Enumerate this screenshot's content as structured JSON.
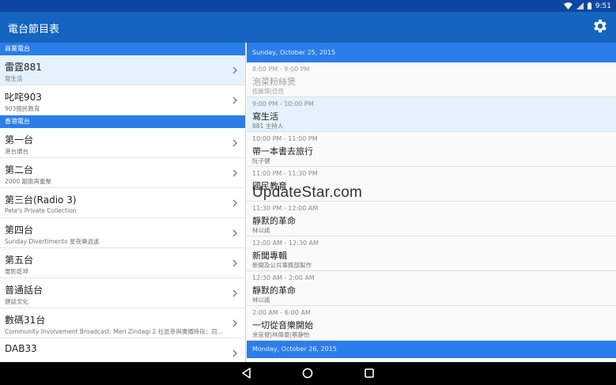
{
  "status": {
    "time": "9:51"
  },
  "app": {
    "title": "電台節目表"
  },
  "sections": [
    {
      "label": "商業電台",
      "stations": [
        {
          "name": "雷霆881",
          "sub": "寫生活",
          "selected": true
        },
        {
          "name": "叱咤903",
          "sub": "903國民教育",
          "selected": false
        }
      ]
    },
    {
      "label": "香港電台",
      "stations": [
        {
          "name": "第一台",
          "sub": "港台讀台",
          "selected": false
        },
        {
          "name": "第二台",
          "sub": "2000 靚歌再重聚",
          "selected": false
        },
        {
          "name": "第三台(Radio 3)",
          "sub": "Pete's Private Collection",
          "selected": false
        },
        {
          "name": "第四台",
          "sub": "Sunday Divertimento 星夜樂逍遙",
          "selected": false
        },
        {
          "name": "第五台",
          "sub": "電影乾坤",
          "selected": false
        },
        {
          "name": "普通話台",
          "sub": "健談文化",
          "selected": false
        },
        {
          "name": "數碼31台",
          "sub": "Community Involvement Broadcast: Meri Zindagi 2 社區參與廣播時段：同...",
          "selected": false
        },
        {
          "name": "DAB33",
          "sub": "",
          "selected": false
        }
      ]
    }
  ],
  "schedule": {
    "date1": "Sunday, October 25, 2015",
    "programs": [
      {
        "time": "8:00 PM - 9:00 PM",
        "title": "泡菜粉絲煲",
        "host": "伍飯琪|伍恆",
        "state": "past"
      },
      {
        "time": "9:00 PM - 10:00 PM",
        "title": "寫生活",
        "host": "881 主持人",
        "state": "current"
      },
      {
        "time": "10:00 PM - 11:00 PM",
        "title": "帶一本書去旅行",
        "host": "阮子健",
        "state": "future"
      },
      {
        "time": "11:00 PM - 11:30 PM",
        "title": "國民教育",
        "host": "",
        "state": "future"
      },
      {
        "time": "11:30 PM - 12:00 AM",
        "title": "靜默的革命",
        "host": "林以諾",
        "state": "future"
      },
      {
        "time": "12:00 AM - 12:30 AM",
        "title": "新聞專輯",
        "host": "新聞及公共事務部製作",
        "state": "future"
      },
      {
        "time": "12:30 AM - 2:00 AM",
        "title": "靜默的革命",
        "host": "林以諾",
        "state": "future"
      },
      {
        "time": "2:00 AM - 6:00 AM",
        "title": "一切從音樂開始",
        "host": "余宜發|林偉豪|蔡靜怡",
        "state": "future"
      }
    ],
    "date2": "Monday, October 26, 2015"
  },
  "watermark": "UpdateStar.com",
  "colors": {
    "primary": "#1565c0",
    "primary_dark": "#0d47a1",
    "section": "#2b7de9",
    "selected": "#e3f2fd"
  }
}
